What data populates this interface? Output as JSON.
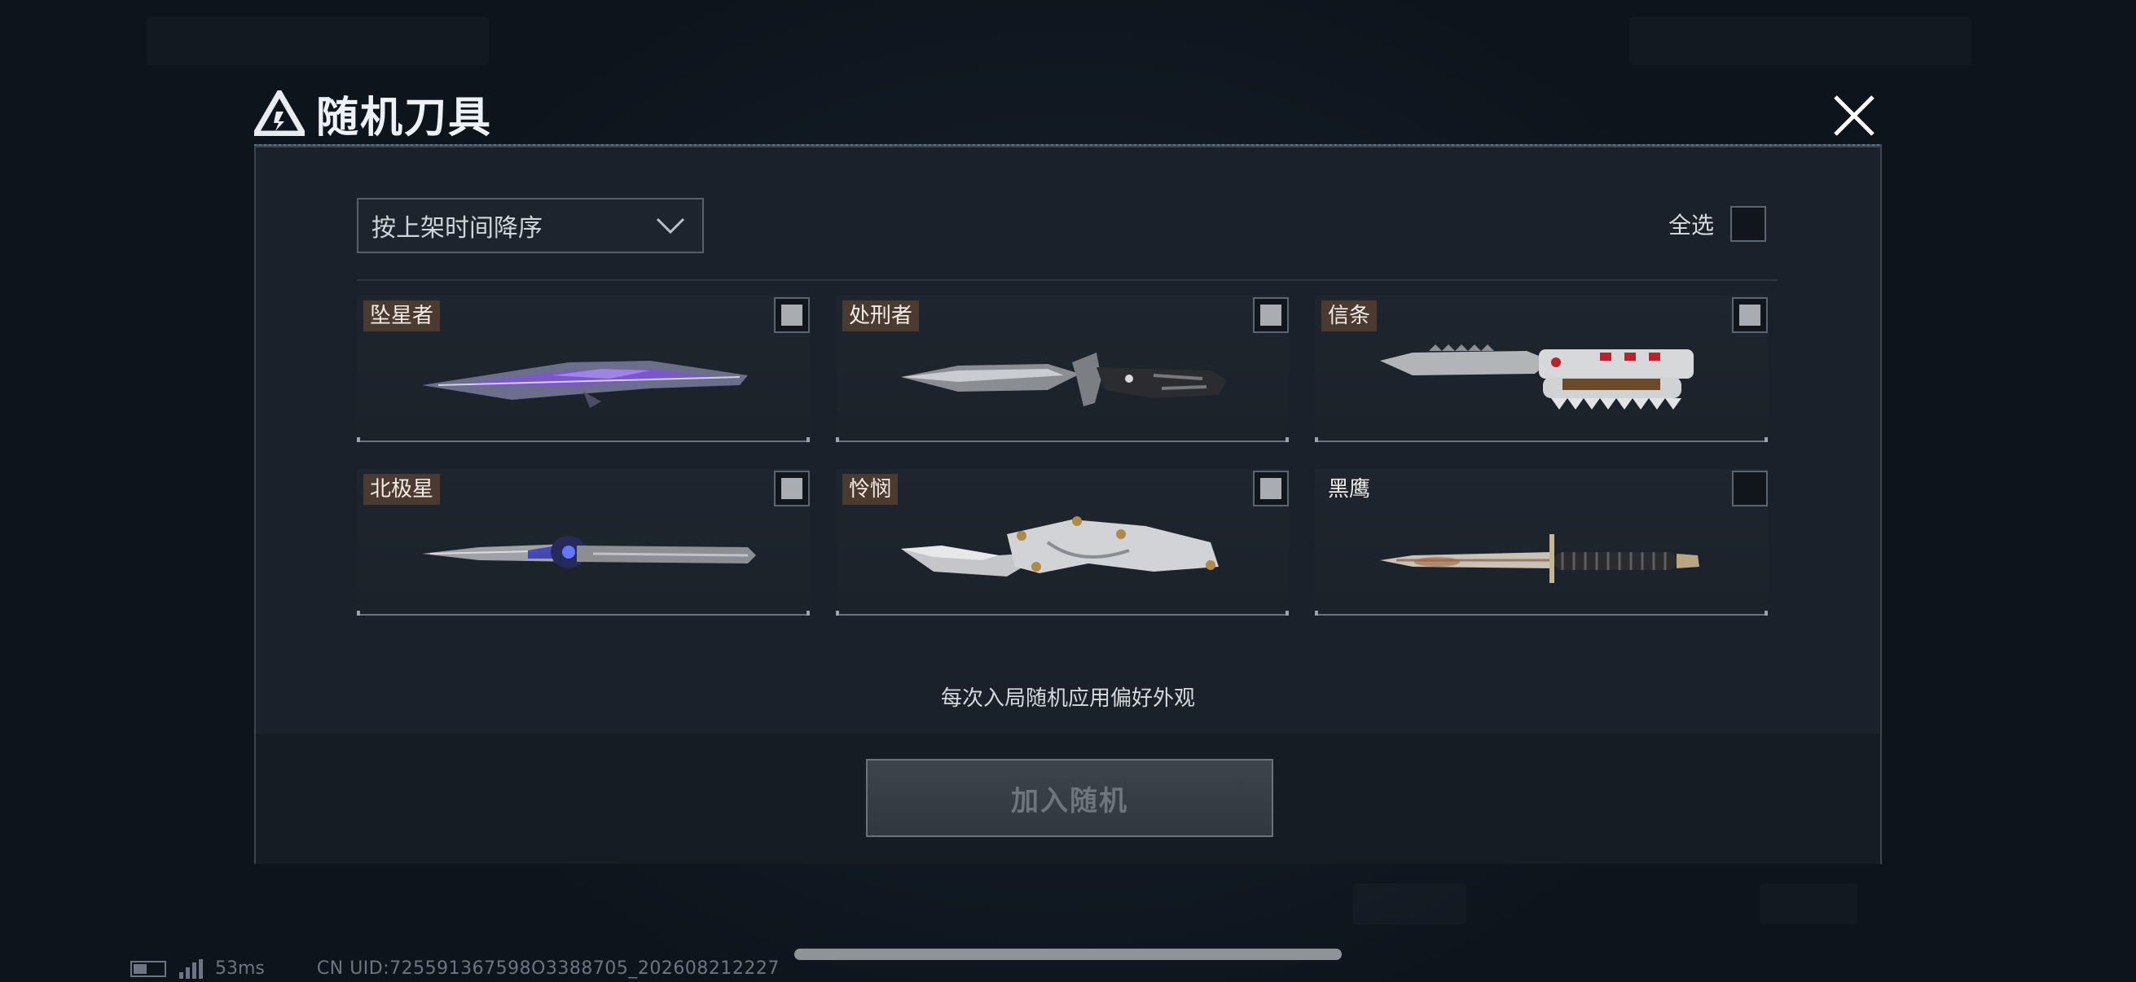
{
  "dialog": {
    "title": "随机刀具",
    "sort_label": "按上架时间降序",
    "select_all_label": "全选",
    "hint": "每次入局随机应用偏好外观",
    "join_button_label": "加入随机"
  },
  "knives": [
    {
      "name": "坠星者",
      "checked": true
    },
    {
      "name": "处刑者",
      "checked": true
    },
    {
      "name": "信条",
      "checked": true
    },
    {
      "name": "北极星",
      "checked": true
    },
    {
      "name": "怜悯",
      "checked": true
    },
    {
      "name": "黑鹰",
      "checked": false
    }
  ],
  "status": {
    "ping": "53ms",
    "uid": "CN UID:725591367598O3388705_202608212227"
  }
}
